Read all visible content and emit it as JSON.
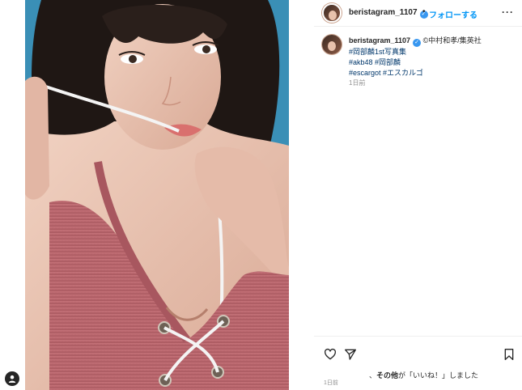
{
  "post": {
    "username": "beristagram_1107",
    "verified_mark": "✓",
    "separator": "•",
    "follow_label": "フォローする",
    "more_label": "···"
  },
  "caption": {
    "username": "beristagram_1107",
    "verified_mark": "✓",
    "credit": "©中村和孝/集英社",
    "hashtags": [
      "#岡部麟1st写真集",
      "#akb48 #岡部麟",
      "#escargot #エスカルゴ"
    ],
    "time": "1日前"
  },
  "footer": {
    "likes_prefix": "、",
    "likes_bold": "その他",
    "likes_suffix": "が「いいね！」しました",
    "time": "1日前"
  },
  "icons": {
    "heart": "heart-icon",
    "comment": "comment-icon",
    "share": "share-icon",
    "save": "bookmark-icon",
    "profile": "user-icon"
  },
  "colors": {
    "link": "#0095f6",
    "hashtag": "#00376b",
    "verified": "#3897f0",
    "muted": "#8e8e8e",
    "swimsuit": "#b9676c",
    "background_sky": "#3a8fb6"
  }
}
